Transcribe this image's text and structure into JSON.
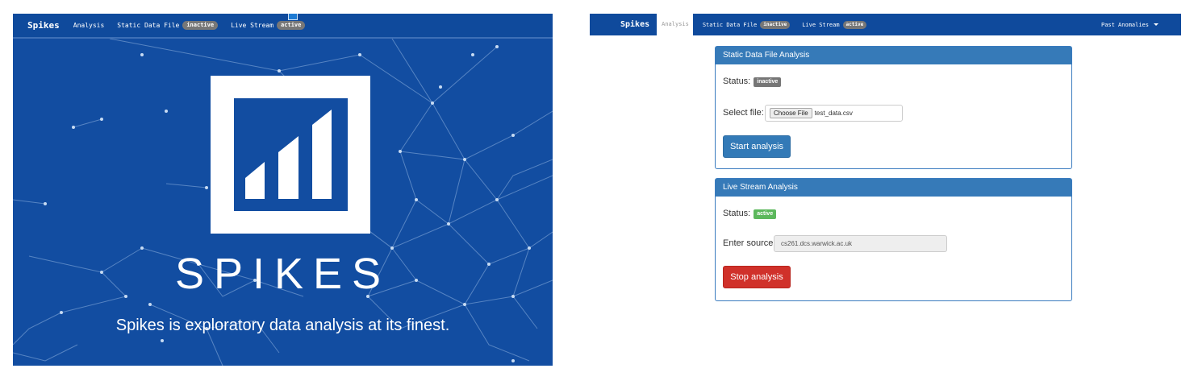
{
  "left_screen": {
    "navbar": {
      "brand": "Spikes",
      "items": [
        {
          "label": "Analysis"
        },
        {
          "label": "Static Data File",
          "badge": "inactive"
        },
        {
          "label": "Live Stream",
          "badge": "active"
        }
      ]
    },
    "hero": {
      "logo_text": "SPIKES",
      "tagline": "Spikes is exploratory data analysis at its finest.",
      "background_color": "#124da1"
    }
  },
  "right_screen": {
    "navbar": {
      "brand": "Spikes",
      "active_tab": "Analysis",
      "items": [
        {
          "label": "Static Data File",
          "badge": "inactive"
        },
        {
          "label": "Live Stream",
          "badge": "active"
        }
      ],
      "dropdown": "Past Anomalies"
    },
    "static_panel": {
      "title": "Static Data File Analysis",
      "status_label": "Status:",
      "status_value": "inactive",
      "select_label": "Select file:",
      "choose_file_label": "Choose File",
      "file_name": "test_data.csv",
      "button": "Start analysis"
    },
    "live_panel": {
      "title": "Live Stream Analysis",
      "status_label": "Status:",
      "status_value": "active",
      "source_label": "Enter source:",
      "source_value": "cs261.dcs.warwick.ac.uk",
      "button": "Stop analysis"
    }
  },
  "colors": {
    "navbar": "#0f4a9c",
    "panel_header": "#367ab8",
    "primary_button": "#337ab7",
    "danger_button": "#d0312a",
    "badge_inactive": "#767676",
    "badge_active": "#5cb85c"
  }
}
